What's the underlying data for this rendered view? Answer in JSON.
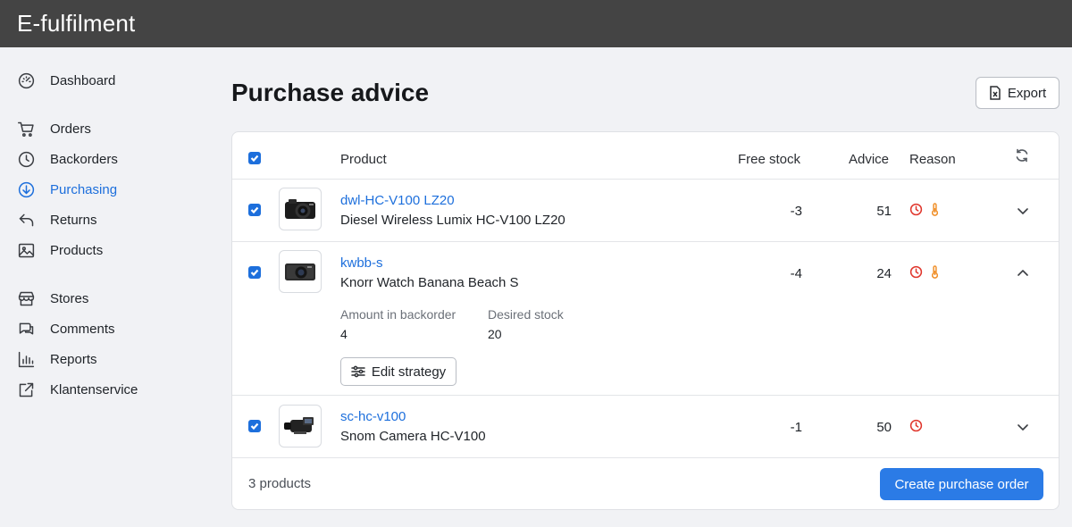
{
  "app": {
    "title": "E-fulfilment"
  },
  "sidebar": {
    "items": [
      {
        "label": "Dashboard",
        "icon": "dashboard-icon"
      },
      {
        "label": "Orders",
        "icon": "cart-icon"
      },
      {
        "label": "Backorders",
        "icon": "clock-icon"
      },
      {
        "label": "Purchasing",
        "icon": "download-circle-icon",
        "active": true
      },
      {
        "label": "Returns",
        "icon": "return-arrow-icon"
      },
      {
        "label": "Products",
        "icon": "image-icon"
      },
      {
        "label": "Stores",
        "icon": "store-icon"
      },
      {
        "label": "Comments",
        "icon": "chat-icon"
      },
      {
        "label": "Reports",
        "icon": "bar-chart-icon"
      },
      {
        "label": "Klantenservice",
        "icon": "external-link-icon"
      }
    ]
  },
  "page": {
    "title": "Purchase advice",
    "export_label": "Export"
  },
  "table": {
    "headers": {
      "product": "Product",
      "free_stock": "Free stock",
      "advice": "Advice",
      "reason": "Reason"
    },
    "rows": [
      {
        "sku": "dwl-HC-V100 LZ20",
        "name": "Diesel Wireless Lumix HC-V100 LZ20",
        "free_stock": "-3",
        "advice": "51",
        "reasons": [
          "clock-icon",
          "thermometer-icon"
        ],
        "expanded": false,
        "image": "compact-camera-image"
      },
      {
        "sku": "kwbb-s",
        "name": "Knorr Watch Banana Beach S",
        "free_stock": "-4",
        "advice": "24",
        "reasons": [
          "clock-icon",
          "thermometer-icon"
        ],
        "expanded": true,
        "image": "point-and-shoot-camera-image",
        "details": {
          "amount_label": "Amount in backorder",
          "amount_value": "4",
          "desired_label": "Desired stock",
          "desired_value": "20",
          "edit_label": "Edit strategy"
        }
      },
      {
        "sku": "sc-hc-v100",
        "name": "Snom Camera HC-V100",
        "free_stock": "-1",
        "advice": "50",
        "reasons": [
          "clock-icon"
        ],
        "expanded": false,
        "image": "camcorder-image"
      }
    ],
    "footer": {
      "count": "3 products",
      "create_label": "Create purchase order"
    }
  },
  "colors": {
    "topbar": "#444444",
    "accent": "#1d6fdc",
    "button": "#2b7be6",
    "clock_red": "#e0352b",
    "thermo_orange": "#f0902a"
  }
}
